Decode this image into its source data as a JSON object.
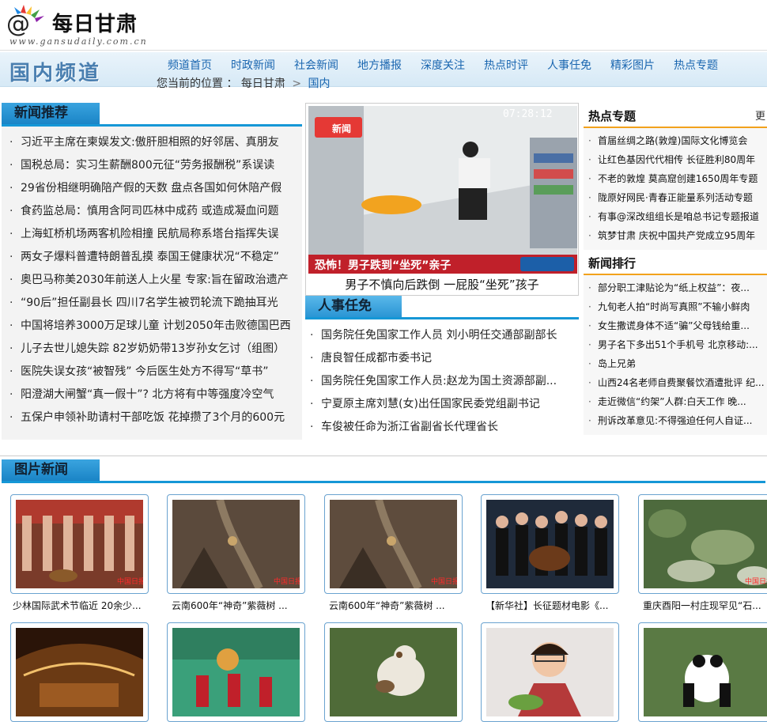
{
  "site": {
    "logo_text": "每日甘肃",
    "logo_url": "www.gansudaily.com.cn",
    "channel": "国内频道"
  },
  "nav": [
    "频道首页",
    "时政新闻",
    "社会新闻",
    "地方播报",
    "深度关注",
    "热点时评",
    "人事任免",
    "精彩图片",
    "热点专题"
  ],
  "breadcrumb": {
    "prefix": "您当前的位置 ：",
    "home": "每日甘肃",
    "sep": ">",
    "current": "国内"
  },
  "news_recommend": {
    "title": "新闻推荐",
    "items": [
      "习近平主席在柬娱发文:傲肝胆相照的好邻居、真朋友",
      "国税总局：实习生薪酬800元征“劳务报酬税”系误读",
      "29省份相继明确陪产假的天数 盘点各国如何休陪产假",
      "食药监总局：慎用含阿司匹林中成药 或造成凝血问题",
      "上海虹桥机场两客机险相撞 民航局称系塔台指挥失误",
      "两女子爆料普遭特朗普乱摸 泰国王健康状况“不稳定”",
      "奥巴马称美2030年前送人上火星 专家:旨在留政治遗产",
      "“90后”担任副县长 四川7名学生被罚轮流下跪抽耳光",
      "中国将培养3000万足球儿童 计划2050年击败德国巴西",
      "儿子去世儿媳失踪 82岁奶奶带13岁孙女乞讨（组图）",
      "医院失误女孩“被智残” 今后医生处方不得写“草书”",
      "阳澄湖大闸蟹“真一假十”? 北方将有中等强度冷空气",
      "五保户申领补助请村干部吃饭 花掉攒了3个月的600元"
    ]
  },
  "video": {
    "logo": "新闻",
    "time": "07:28:12",
    "banner": "恐怖！男子跌到“坐死”亲子",
    "caption": "男子不慎向后跌倒 一屁股“坐死”孩子"
  },
  "personnel": {
    "title": "人事任免",
    "items": [
      "国务院任免国家工作人员 刘小明任交通部副部长",
      "唐良智任成都市委书记",
      "国务院任免国家工作人员:赵龙为国土资源部副...",
      "宁夏原主席刘慧(女)出任国家民委党组副书记",
      "车俊被任命为浙江省副省长代理省长"
    ]
  },
  "hot_topics": {
    "title": "热点专题",
    "more": "更",
    "items": [
      "首届丝绸之路(敦煌)国际文化博览会",
      "让红色基因代代相传 长征胜利80周年",
      "不老的敦煌 莫高窟创建1650周年专题",
      "陇原好网民·青春正能量系列活动专题",
      "有事@深改组组长是咱总书记专题报道",
      "筑梦甘肃 庆祝中国共产党成立95周年"
    ]
  },
  "ranking": {
    "title": "新闻排行",
    "items": [
      "部分职工津贴论为“纸上权益”：夜...",
      "九旬老人拍“时尚写真照”不输小鲜肉",
      "女生撒谎身体不适“骗”父母钱给重...",
      "男子名下多出51个手机号 北京移动:...",
      "岛上兄弟",
      "山西24名老师自费聚餐饮酒遭批评 纪...",
      "走近微信“约架”人群:白天工作 晚...",
      "刑诉改革意见:不得强迫任何人自证..."
    ]
  },
  "photo_news": {
    "title": "图片新闻",
    "row1": [
      "少林国际武术节临近 20余少...",
      "云南600年“神奇”紫薇树 ...",
      "云南600年“神奇”紫薇树 ...",
      "【新华社】长征题材电影《...",
      "重庆酉阳一村庄现罕见“石..."
    ],
    "watermark": "中国日报"
  },
  "colors": {
    "accent_blue": "#1597d6",
    "nav_link": "#1a66b0",
    "side_accent": "#f2a21c"
  }
}
